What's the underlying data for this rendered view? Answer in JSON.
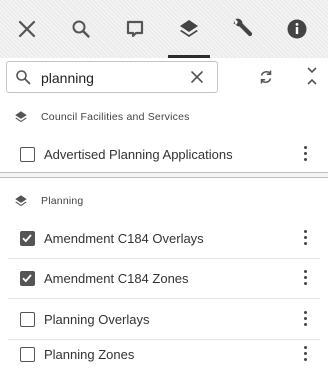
{
  "toolbar": {
    "buttons": [
      {
        "icon": "close-icon",
        "active": false
      },
      {
        "icon": "search-icon",
        "active": false
      },
      {
        "icon": "comment-icon",
        "active": false
      },
      {
        "icon": "layers-icon",
        "active": true
      },
      {
        "icon": "wrench-icon",
        "active": false
      },
      {
        "icon": "info-icon",
        "active": false
      }
    ]
  },
  "search": {
    "value": "planning",
    "placeholder": ""
  },
  "groups": [
    {
      "label": "Council Facilities and Services",
      "layers": [
        {
          "label": "Advertised Planning Applications",
          "checked": false
        }
      ]
    },
    {
      "label": "Planning",
      "layers": [
        {
          "label": "Amendment C184 Overlays",
          "checked": true
        },
        {
          "label": "Amendment C184 Zones",
          "checked": true
        },
        {
          "label": "Planning Overlays",
          "checked": false
        },
        {
          "label": "Planning Zones",
          "checked": false
        }
      ]
    }
  ],
  "colors": {
    "icon": "#555555",
    "checkbox": "#555555",
    "toolbar_bg": "#ececec"
  }
}
